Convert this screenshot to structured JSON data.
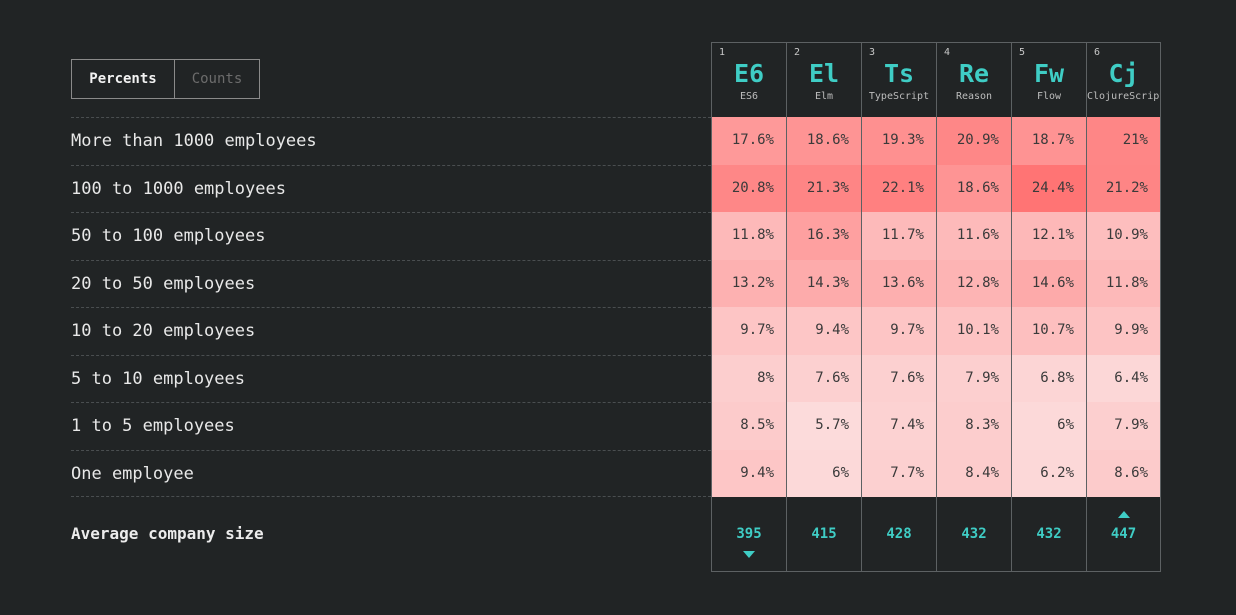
{
  "toggle": {
    "percents_label": "Percents",
    "counts_label": "Counts"
  },
  "rows": [
    "More than 1000 employees",
    "100 to 1000 employees",
    "50 to 100 employees",
    "20 to 50 employees",
    "10 to 20 employees",
    "5 to 10 employees",
    "1 to 5 employees",
    "One employee"
  ],
  "average_label": "Average company size",
  "columns": [
    {
      "index": "1",
      "abbr": "E6",
      "name": "ES6",
      "average": "395",
      "marker": "down",
      "values": [
        "17.6%",
        "20.8%",
        "11.8%",
        "13.2%",
        "9.7%",
        "8%",
        "8.5%",
        "9.4%"
      ]
    },
    {
      "index": "2",
      "abbr": "El",
      "name": "Elm",
      "average": "415",
      "marker": "",
      "values": [
        "18.6%",
        "21.3%",
        "16.3%",
        "14.3%",
        "9.4%",
        "7.6%",
        "5.7%",
        "6%"
      ]
    },
    {
      "index": "3",
      "abbr": "Ts",
      "name": "TypeScript",
      "average": "428",
      "marker": "",
      "values": [
        "19.3%",
        "22.1%",
        "11.7%",
        "13.6%",
        "9.7%",
        "7.6%",
        "7.4%",
        "7.7%"
      ]
    },
    {
      "index": "4",
      "abbr": "Re",
      "name": "Reason",
      "average": "432",
      "marker": "",
      "values": [
        "20.9%",
        "18.6%",
        "11.6%",
        "12.8%",
        "10.1%",
        "7.9%",
        "8.3%",
        "8.4%"
      ]
    },
    {
      "index": "5",
      "abbr": "Fw",
      "name": "Flow",
      "average": "432",
      "marker": "",
      "values": [
        "18.7%",
        "24.4%",
        "12.1%",
        "14.6%",
        "10.7%",
        "6.8%",
        "6%",
        "6.2%"
      ]
    },
    {
      "index": "6",
      "abbr": "Cj",
      "name": "ClojureScript",
      "average": "447",
      "marker": "up",
      "values": [
        "21%",
        "21.2%",
        "10.9%",
        "11.8%",
        "9.9%",
        "6.4%",
        "7.9%",
        "8.6%"
      ]
    }
  ],
  "colors": {
    "accent": "#3fcdc5",
    "background": "#212425",
    "heat_low": "#fcdcdc",
    "heat_high": "#ff7373"
  }
}
